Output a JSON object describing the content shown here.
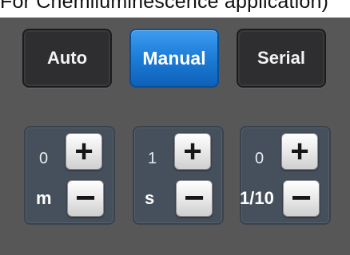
{
  "caption": "For Chemiluminescence application)",
  "modes": {
    "auto": "Auto",
    "manual": "Manual",
    "serial": "Serial",
    "active": "manual"
  },
  "units": [
    {
      "value": "0",
      "label": "m",
      "plus": "+",
      "minus": "−"
    },
    {
      "value": "1",
      "label": "s",
      "plus": "+",
      "minus": "−"
    },
    {
      "value": "0",
      "label": "1/10",
      "plus": "+",
      "minus": "−"
    }
  ],
  "colors": {
    "panel": "#575757",
    "active_button": "#1f7fd9",
    "inactive_button": "#2e2e31",
    "unit_background": "#46505c"
  }
}
